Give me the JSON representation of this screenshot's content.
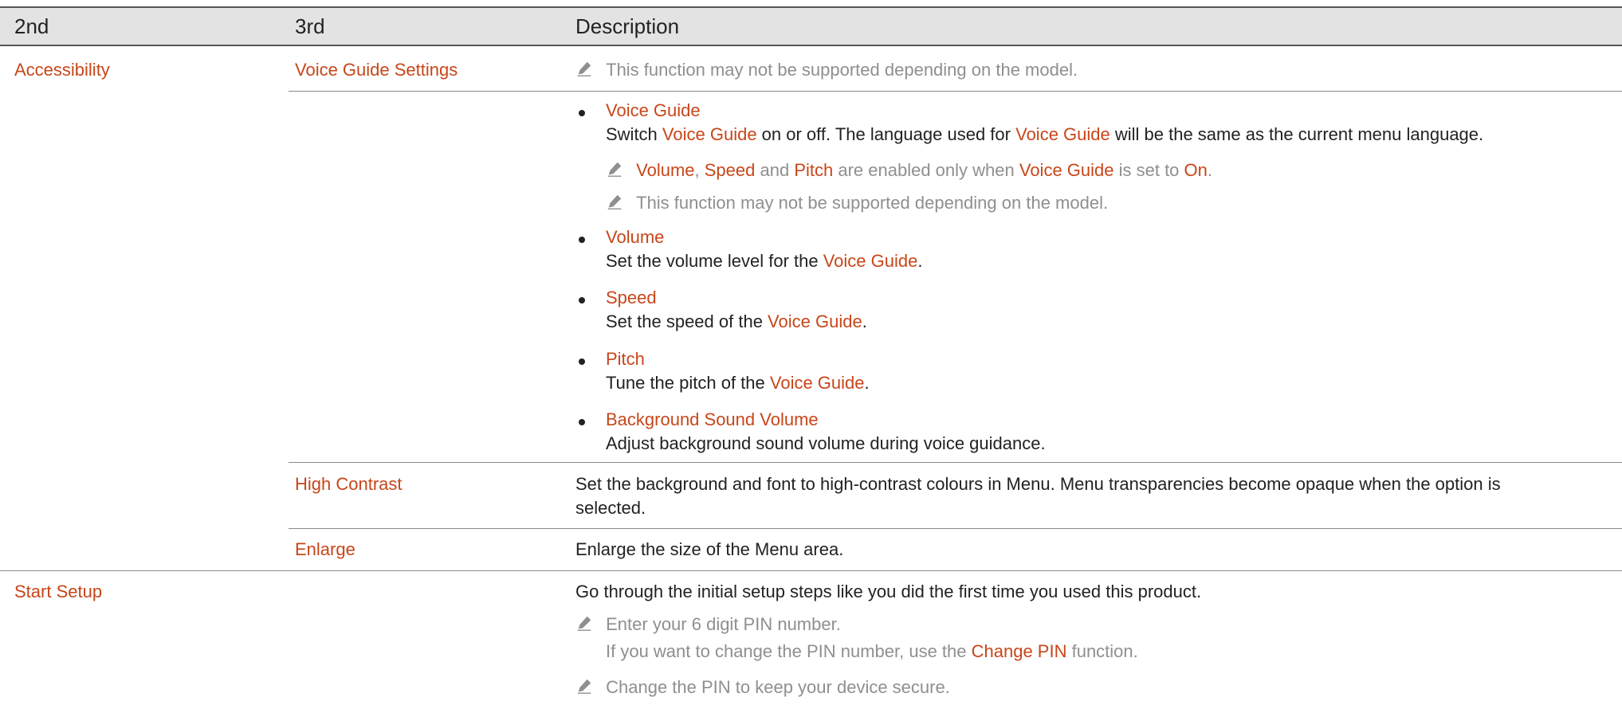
{
  "header": {
    "col2": "2nd",
    "col3": "3rd",
    "col_desc": "Description"
  },
  "accessibility": {
    "label": "Accessibility",
    "voice_guide_settings": {
      "label": "Voice Guide Settings",
      "note": "This function may not be supported depending on the model.",
      "items": {
        "voice_guide": {
          "title": "Voice Guide",
          "desc": {
            "p1": "Switch ",
            "l1": "Voice Guide",
            "p2": " on or off. The language used for ",
            "l2": "Voice Guide",
            "p3": " will be the same as the current menu language."
          },
          "note1": {
            "l_volume": "Volume",
            "sep1": ", ",
            "l_speed": "Speed",
            "sep2": " and ",
            "l_pitch": "Pitch",
            "p": " are enabled only when ",
            "l_vg": "Voice Guide",
            "p2": " is set to ",
            "l_on": "On",
            "end": "."
          },
          "note2": "This function may not be supported depending on the model."
        },
        "volume": {
          "title": "Volume",
          "p1": "Set the volume level for the ",
          "l": "Voice Guide",
          "end": "."
        },
        "speed": {
          "title": "Speed",
          "p1": "Set the speed of the ",
          "l": "Voice Guide",
          "end": "."
        },
        "pitch": {
          "title": "Pitch",
          "p1": "Tune the pitch of the ",
          "l": "Voice Guide",
          "end": "."
        },
        "background": {
          "title": "Background Sound Volume",
          "desc": "Adjust background sound volume during voice guidance."
        }
      }
    },
    "high_contrast": {
      "label": "High Contrast",
      "desc_line1": "Set the background and font to high-contrast colours in Menu. Menu transparencies become opaque when the option is",
      "desc_line2": "selected."
    },
    "enlarge": {
      "label": "Enlarge",
      "desc": "Enlarge the size of the Menu area."
    }
  },
  "start_setup": {
    "label": "Start Setup",
    "desc": "Go through the initial setup steps like you did the first time you used this product.",
    "note1_line1": "Enter your 6 digit PIN number.",
    "note1_line2_pre": "If you want to change the PIN number, use the ",
    "note1_link": "Change PIN",
    "note1_line2_post": " function.",
    "note2": "Change the PIN to keep your device secure."
  },
  "colors": {
    "accent": "#c8461a",
    "note_gray": "#8f8f8f",
    "header_bg": "#e3e3e3"
  }
}
